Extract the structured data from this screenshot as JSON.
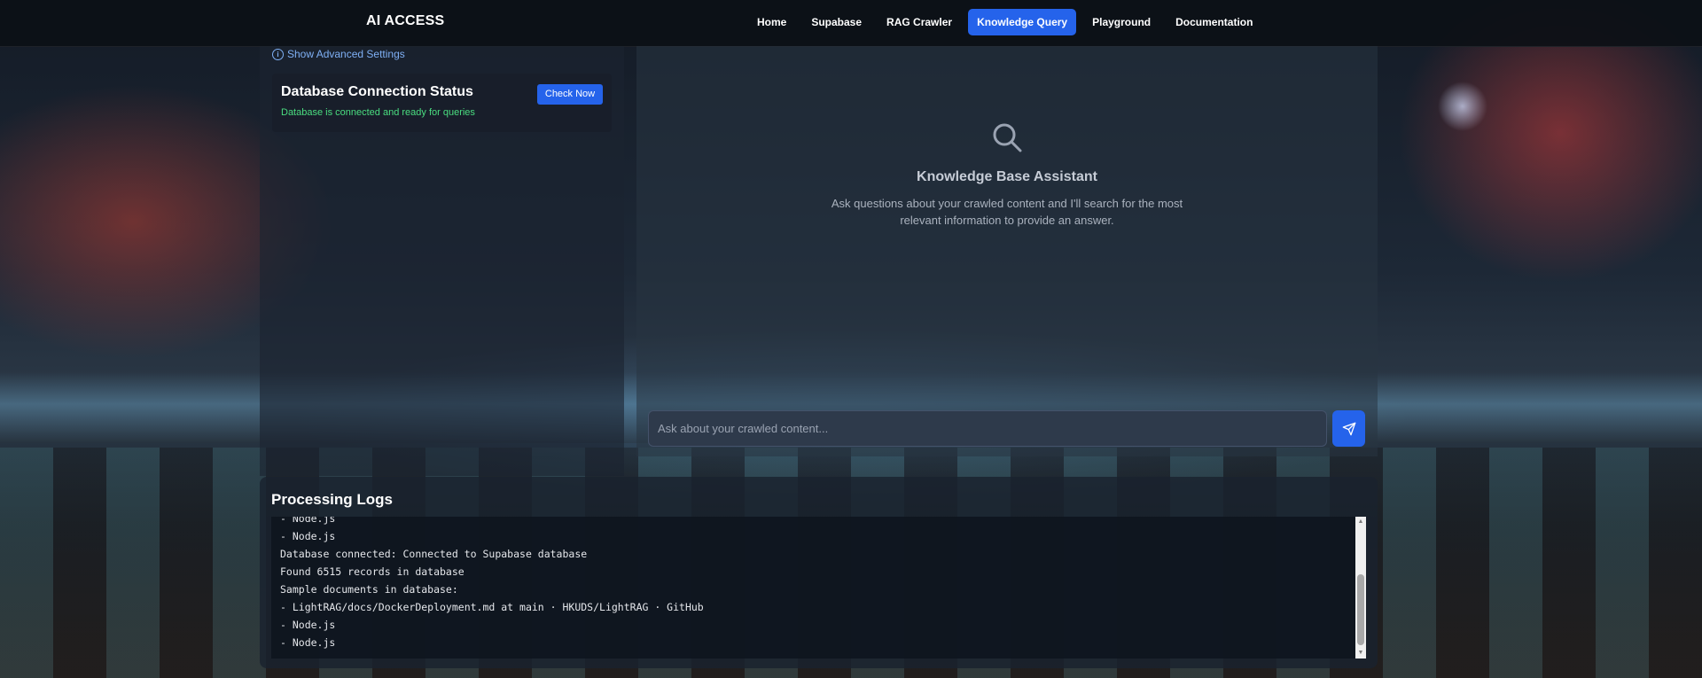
{
  "app": {
    "brand": "AI ACCESS"
  },
  "nav": {
    "items": [
      {
        "label": "Home",
        "active": false
      },
      {
        "label": "Supabase",
        "active": false
      },
      {
        "label": "RAG Crawler",
        "active": false
      },
      {
        "label": "Knowledge Query",
        "active": true
      },
      {
        "label": "Playground",
        "active": false
      },
      {
        "label": "Documentation",
        "active": false
      }
    ]
  },
  "sidebar": {
    "advanced_link": "Show Advanced Settings",
    "status_card": {
      "title": "Database Connection Status",
      "message": "Database is connected and ready for queries",
      "check_button": "Check Now"
    }
  },
  "chat": {
    "title": "Knowledge Base Assistant",
    "description": "Ask questions about your crawled content and I'll search for the most relevant information to provide an answer.",
    "input_placeholder": "Ask about your crawled content...",
    "input_value": ""
  },
  "logs": {
    "title": "Processing Logs",
    "lines": [
      "- Node.js",
      "- Node.js",
      "Database connected: Connected to Supabase database",
      "Found 6515 records in database",
      "Sample documents in database:",
      "- LightRAG/docs/DockerDeployment.md at main · HKUDS/LightRAG · GitHub",
      "- Node.js",
      "- Node.js"
    ]
  },
  "colors": {
    "accent": "#2563eb",
    "success": "#4ade80",
    "link": "#7fb0f5"
  },
  "icons": {
    "info": "info-icon",
    "search": "search-icon",
    "send": "send-icon"
  }
}
